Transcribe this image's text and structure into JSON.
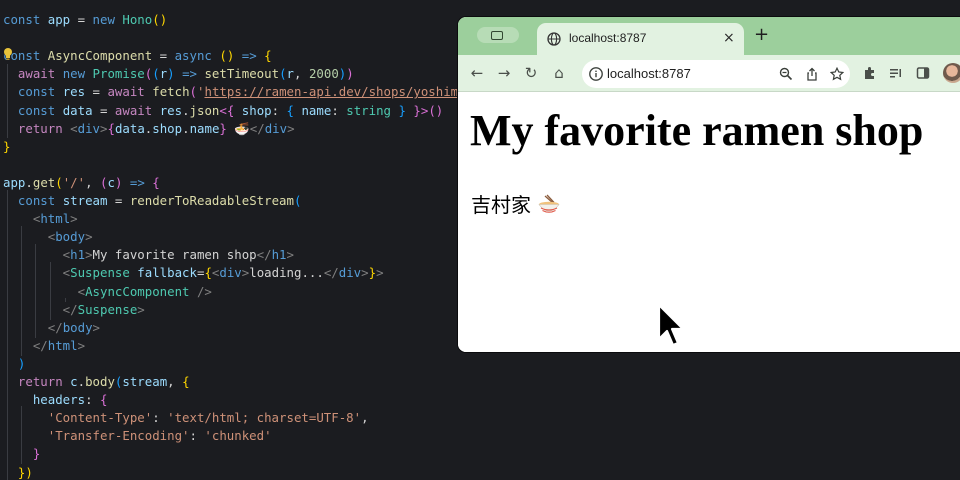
{
  "editor": {
    "lines": [
      [
        [
          "const ",
          "t-kw"
        ],
        [
          "app",
          "t-var"
        ],
        [
          " = ",
          "t-txt"
        ],
        [
          "new ",
          "t-kw"
        ],
        [
          "Hono",
          "t-cls"
        ],
        [
          "()",
          "t-br1"
        ]
      ],
      [],
      [
        [
          "const ",
          "t-kw"
        ],
        [
          "AsyncComponent",
          "t-fn"
        ],
        [
          " = ",
          "t-txt"
        ],
        [
          "async ",
          "t-kw"
        ],
        [
          "() ",
          "t-br1"
        ],
        [
          "=> ",
          "t-kw"
        ],
        [
          "{",
          "t-br1"
        ]
      ],
      [
        [
          "  await ",
          "t-kw2"
        ],
        [
          "new ",
          "t-kw"
        ],
        [
          "Promise",
          "t-cls"
        ],
        [
          "(",
          "t-br2"
        ],
        [
          "(",
          "t-br3"
        ],
        [
          "r",
          "t-var"
        ],
        [
          ") ",
          "t-br3"
        ],
        [
          "=> ",
          "t-kw"
        ],
        [
          "setTimeout",
          "t-fn"
        ],
        [
          "(",
          "t-br3"
        ],
        [
          "r",
          "t-var"
        ],
        [
          ", ",
          "t-txt"
        ],
        [
          "2000",
          "t-num"
        ],
        [
          ")",
          "t-br3"
        ],
        [
          ")",
          "t-br2"
        ]
      ],
      [
        [
          "  const ",
          "t-kw"
        ],
        [
          "res",
          "t-var"
        ],
        [
          " = ",
          "t-txt"
        ],
        [
          "await ",
          "t-kw2"
        ],
        [
          "fetch",
          "t-fn"
        ],
        [
          "(",
          "t-br2"
        ],
        [
          "'",
          "t-str"
        ],
        [
          "https://ramen-api.dev/shops/yoshimuraya",
          "t-url"
        ],
        [
          "'",
          "t-str"
        ],
        [
          ")",
          "t-br2"
        ]
      ],
      [
        [
          "  const ",
          "t-kw"
        ],
        [
          "data",
          "t-var"
        ],
        [
          " = ",
          "t-txt"
        ],
        [
          "await ",
          "t-kw2"
        ],
        [
          "res",
          "t-var"
        ],
        [
          ".",
          "t-txt"
        ],
        [
          "json",
          "t-fn"
        ],
        [
          "<{ ",
          "t-br2"
        ],
        [
          "shop",
          "t-var"
        ],
        [
          ": ",
          "t-txt"
        ],
        [
          "{ ",
          "t-br3"
        ],
        [
          "name",
          "t-var"
        ],
        [
          ": ",
          "t-txt"
        ],
        [
          "string",
          "t-cls"
        ],
        [
          " } ",
          "t-br3"
        ],
        [
          "}>",
          "t-br2"
        ],
        [
          "()",
          "t-br2"
        ]
      ],
      [
        [
          "  return ",
          "t-kw2"
        ],
        [
          "<",
          "t-ang"
        ],
        [
          "div",
          "t-kw"
        ],
        [
          ">",
          "t-ang"
        ],
        [
          "{",
          "t-br2"
        ],
        [
          "data",
          "t-var"
        ],
        [
          ".",
          "t-txt"
        ],
        [
          "shop",
          "t-var"
        ],
        [
          ".",
          "t-txt"
        ],
        [
          "name",
          "t-var"
        ],
        [
          "}",
          "t-br2"
        ],
        [
          " 🍜",
          "t-txt"
        ],
        [
          "</",
          "t-ang"
        ],
        [
          "div",
          "t-kw"
        ],
        [
          ">",
          "t-ang"
        ]
      ],
      [
        [
          "}",
          "t-br1"
        ]
      ],
      [],
      [
        [
          "app",
          "t-var"
        ],
        [
          ".",
          "t-txt"
        ],
        [
          "get",
          "t-fn"
        ],
        [
          "(",
          "t-br1"
        ],
        [
          "'/'",
          "t-str"
        ],
        [
          ", ",
          "t-txt"
        ],
        [
          "(",
          "t-br2"
        ],
        [
          "c",
          "t-var"
        ],
        [
          ") ",
          "t-br2"
        ],
        [
          "=> ",
          "t-kw"
        ],
        [
          "{",
          "t-br2"
        ]
      ],
      [
        [
          "  const ",
          "t-kw"
        ],
        [
          "stream",
          "t-var"
        ],
        [
          " = ",
          "t-txt"
        ],
        [
          "renderToReadableStream",
          "t-fn"
        ],
        [
          "(",
          "t-br3"
        ]
      ],
      [
        [
          "    <",
          "t-ang"
        ],
        [
          "html",
          "t-kw"
        ],
        [
          ">",
          "t-ang"
        ]
      ],
      [
        [
          "      <",
          "t-ang"
        ],
        [
          "body",
          "t-kw"
        ],
        [
          ">",
          "t-ang"
        ]
      ],
      [
        [
          "        <",
          "t-ang"
        ],
        [
          "h1",
          "t-kw"
        ],
        [
          ">",
          "t-ang"
        ],
        [
          "My favorite ramen shop",
          "t-txt"
        ],
        [
          "</",
          "t-ang"
        ],
        [
          "h1",
          "t-kw"
        ],
        [
          ">",
          "t-ang"
        ]
      ],
      [
        [
          "        <",
          "t-ang"
        ],
        [
          "Suspense ",
          "t-tag"
        ],
        [
          "fallback",
          "t-attr"
        ],
        [
          "=",
          "t-txt"
        ],
        [
          "{",
          "t-br1"
        ],
        [
          "<",
          "t-ang"
        ],
        [
          "div",
          "t-kw"
        ],
        [
          ">",
          "t-ang"
        ],
        [
          "loading...",
          "t-txt"
        ],
        [
          "</",
          "t-ang"
        ],
        [
          "div",
          "t-kw"
        ],
        [
          ">",
          "t-ang"
        ],
        [
          "}",
          "t-br1"
        ],
        [
          ">",
          "t-ang"
        ]
      ],
      [
        [
          "          <",
          "t-ang"
        ],
        [
          "AsyncComponent ",
          "t-tag"
        ],
        [
          "/>",
          "t-ang"
        ]
      ],
      [
        [
          "        </",
          "t-ang"
        ],
        [
          "Suspense",
          "t-tag"
        ],
        [
          ">",
          "t-ang"
        ]
      ],
      [
        [
          "      </",
          "t-ang"
        ],
        [
          "body",
          "t-kw"
        ],
        [
          ">",
          "t-ang"
        ]
      ],
      [
        [
          "    </",
          "t-ang"
        ],
        [
          "html",
          "t-kw"
        ],
        [
          ">",
          "t-ang"
        ]
      ],
      [
        [
          "  )",
          "t-br3"
        ]
      ],
      [
        [
          "  return ",
          "t-kw2"
        ],
        [
          "c",
          "t-var"
        ],
        [
          ".",
          "t-txt"
        ],
        [
          "body",
          "t-fn"
        ],
        [
          "(",
          "t-br3"
        ],
        [
          "stream",
          "t-var"
        ],
        [
          ", ",
          "t-txt"
        ],
        [
          "{",
          "t-br1"
        ]
      ],
      [
        [
          "    headers",
          "t-var"
        ],
        [
          ": ",
          "t-txt"
        ],
        [
          "{",
          "t-br2"
        ]
      ],
      [
        [
          "      'Content-Type'",
          "t-str"
        ],
        [
          ": ",
          "t-txt"
        ],
        [
          "'text/html; charset=UTF-8'",
          "t-str"
        ],
        [
          ",",
          "t-txt"
        ]
      ],
      [
        [
          "      'Transfer-Encoding'",
          "t-str"
        ],
        [
          ": ",
          "t-txt"
        ],
        [
          "'chunked'",
          "t-str"
        ]
      ],
      [
        [
          "    }",
          "t-br2"
        ]
      ],
      [
        [
          "  })",
          "t-br1"
        ]
      ]
    ]
  },
  "browser": {
    "tab_title": "localhost:8787",
    "tab_close_label": "×",
    "new_tab_label": "+",
    "address": "localhost:8787",
    "toolbar_icons": [
      "back-icon",
      "forward-icon",
      "reload-icon",
      "home-icon"
    ],
    "page": {
      "heading": "My favorite ramen shop",
      "shop_name": "吉村家"
    }
  },
  "colors": {
    "editor_bg": "#1b1c20",
    "tabstrip_bg": "#9ccf9c",
    "toolbar_bg": "#e2f2e1"
  }
}
